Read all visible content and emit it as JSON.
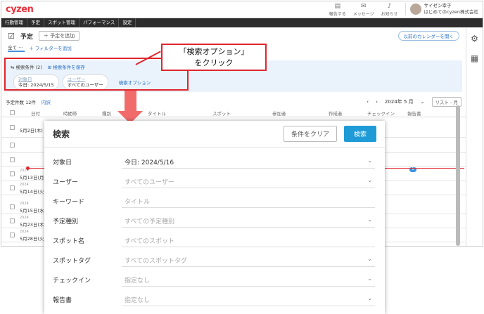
{
  "topbar": {
    "logo": "cyzen",
    "items": [
      {
        "icon": "report-icon",
        "glyph": "▤",
        "label": "報告する"
      },
      {
        "icon": "message-icon",
        "glyph": "✉",
        "label": "メッセージ"
      },
      {
        "icon": "bell-icon",
        "glyph": "♪",
        "label": "お知らせ"
      }
    ],
    "user": {
      "name": "サイゼン幸子",
      "company": "はじめてのcyzen株式会社"
    }
  },
  "nav": [
    "行動管理",
    "予定",
    "スポット管理",
    "パフォーマンス",
    "設定"
  ],
  "header": {
    "title": "予定",
    "add_button": "＋ 予定を追加",
    "old_calendar": "以前のカレンダーを開く"
  },
  "filter": {
    "all": "全て ···",
    "add_filter": "＋ フィルターを追加"
  },
  "conditions": {
    "label": "⇆ 検索条件 (2)",
    "save": "⊞ 検索条件を保存",
    "chips": [
      {
        "label": "対象日",
        "value": "今日: 2024/5/15"
      },
      {
        "label": "ユーザー",
        "value": "すべてのユーザー"
      }
    ],
    "option_link": "検索オプション"
  },
  "callout": {
    "line1": "「検索オプション」",
    "line2": "をクリック"
  },
  "list": {
    "count": "予定件数 12件",
    "breakdown": "内訳",
    "month": "2024年 5 月",
    "view": "リスト - 月"
  },
  "table": {
    "headers": [
      "日付",
      "時間帯",
      "種別",
      "タイトル",
      "スポット",
      "参加者",
      "作成者",
      "チェックイン",
      "報告書"
    ],
    "rows": [
      {
        "year": "",
        "date": "5月2日(木)"
      },
      {
        "year": "",
        "date": ""
      },
      {
        "year": "",
        "date": ""
      },
      {
        "year": "2024",
        "date": "5月13日(月)"
      },
      {
        "year": "2024",
        "date": "5月14日(火)"
      },
      {
        "year": "2024",
        "date": "5月15日(水)"
      },
      {
        "year": "2024",
        "date": "5月23日(木)"
      },
      {
        "year": "2024",
        "date": "5月28日(火)"
      }
    ],
    "badge": "1"
  },
  "modal": {
    "title": "検索",
    "clear": "条件をクリア",
    "search": "検索",
    "fields": [
      {
        "label": "対象日",
        "value": "今日: 2024/5/16",
        "filled": true
      },
      {
        "label": "ユーザー",
        "value": "すべてのユーザー",
        "filled": false
      },
      {
        "label": "キーワード",
        "value": "タイトル",
        "filled": false
      },
      {
        "label": "予定種別",
        "value": "すべての予定種別",
        "filled": false
      },
      {
        "label": "スポット名",
        "value": "すべてのスポット",
        "filled": false
      },
      {
        "label": "スポットタグ",
        "value": "すべてのスポットタグ",
        "filled": false
      },
      {
        "label": "チェックイン",
        "value": "指定なし",
        "filled": false
      },
      {
        "label": "報告書",
        "value": "指定なし",
        "filled": false
      }
    ]
  }
}
